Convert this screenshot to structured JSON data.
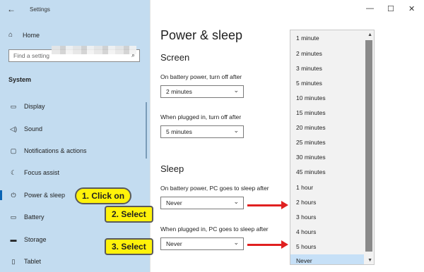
{
  "window": {
    "title": "Settings",
    "back_icon": "←",
    "minimize": "—",
    "maximize": "☐",
    "close": "✕"
  },
  "sidebar": {
    "home_label": "Home",
    "search_placeholder": "Find a setting",
    "section_label": "System",
    "items": [
      {
        "label": "Display",
        "icon": "display-icon"
      },
      {
        "label": "Sound",
        "icon": "sound-icon"
      },
      {
        "label": "Notifications & actions",
        "icon": "notifications-icon"
      },
      {
        "label": "Focus assist",
        "icon": "moon-icon"
      },
      {
        "label": "Power & sleep",
        "icon": "power-icon"
      },
      {
        "label": "Battery",
        "icon": "battery-icon"
      },
      {
        "label": "Storage",
        "icon": "storage-icon"
      },
      {
        "label": "Tablet",
        "icon": "tablet-icon"
      }
    ]
  },
  "main": {
    "title": "Power & sleep",
    "screen_heading": "Screen",
    "battery_screen_label": "On battery power, turn off after",
    "battery_screen_value": "2 minutes",
    "plugged_screen_label": "When plugged in, turn off after",
    "plugged_screen_value": "5 minutes",
    "sleep_heading": "Sleep",
    "battery_sleep_label": "On battery power, PC goes to sleep after",
    "battery_sleep_value": "Never",
    "plugged_sleep_label": "When plugged in, PC goes to sleep after",
    "plugged_sleep_value": "Never"
  },
  "dropdown": {
    "options": [
      "1 minute",
      "2 minutes",
      "3 minutes",
      "5 minutes",
      "10 minutes",
      "15 minutes",
      "20 minutes",
      "25 minutes",
      "30 minutes",
      "45 minutes",
      "1 hour",
      "2 hours",
      "3 hours",
      "4 hours",
      "5 hours",
      "Never"
    ],
    "selected": "Never"
  },
  "callouts": {
    "step1": "1. Click on",
    "step2": "2. Select",
    "step3": "3. Select"
  },
  "colors": {
    "accent": "#0a64b4",
    "callout": "#fff20a",
    "arrow": "#e02020",
    "sidebar_bg": "#c3dcf0"
  }
}
